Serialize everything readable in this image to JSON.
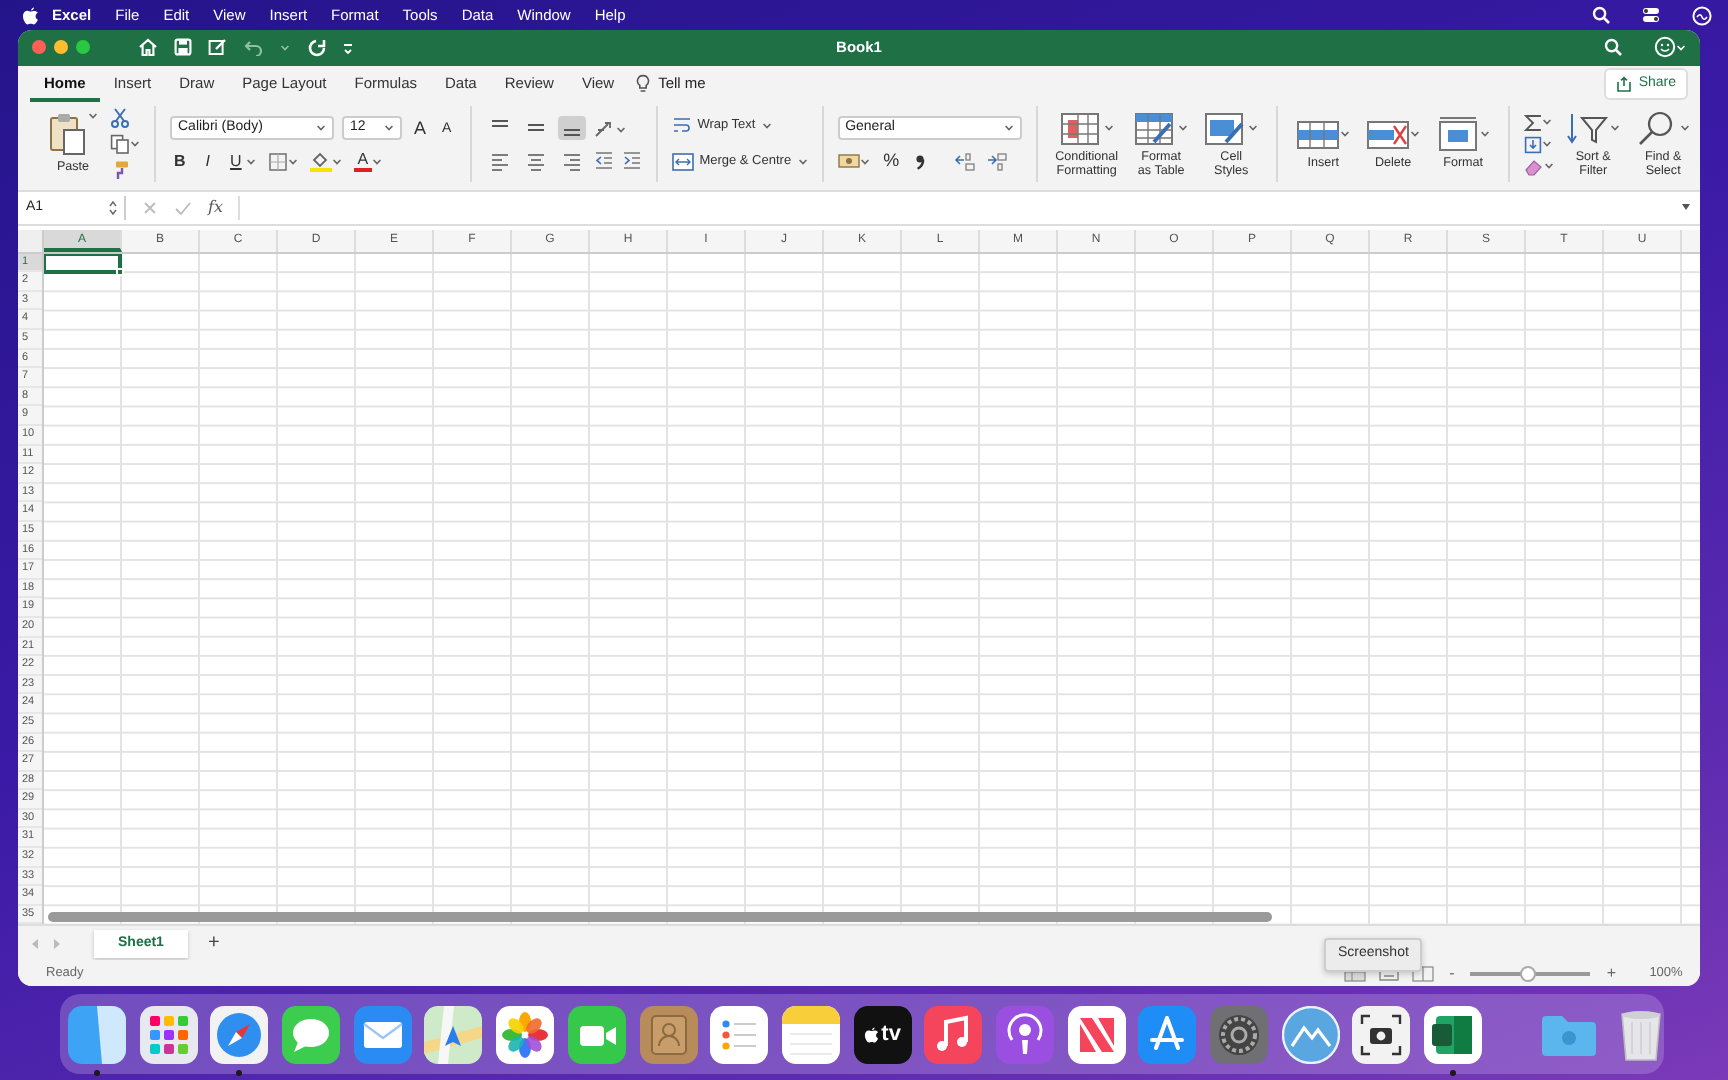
{
  "menubar": {
    "items": [
      {
        "label": "Excel",
        "kind": "app"
      },
      {
        "label": "File",
        "kind": "menu"
      },
      {
        "label": "Edit",
        "kind": "menu"
      },
      {
        "label": "View",
        "kind": "menu"
      },
      {
        "label": "Insert",
        "kind": "menu"
      },
      {
        "label": "Format",
        "kind": "menu"
      },
      {
        "label": "Tools",
        "kind": "menu"
      },
      {
        "label": "Data",
        "kind": "menu"
      },
      {
        "label": "Window",
        "kind": "menu"
      },
      {
        "label": "Help",
        "kind": "menu"
      }
    ]
  },
  "window": {
    "title": "Book1"
  },
  "ribbon_tabs": [
    {
      "label": "Home",
      "selected": true
    },
    {
      "label": "Insert",
      "selected": false
    },
    {
      "label": "Draw",
      "selected": false
    },
    {
      "label": "Page Layout",
      "selected": false
    },
    {
      "label": "Formulas",
      "selected": false
    },
    {
      "label": "Data",
      "selected": false
    },
    {
      "label": "Review",
      "selected": false
    },
    {
      "label": "View",
      "selected": false
    }
  ],
  "tell_me": "Tell me",
  "share": "Share",
  "clipboard": {
    "paste": "Paste"
  },
  "font": {
    "name": "Calibri (Body)",
    "size": "12",
    "grow": "A",
    "shrink": "A",
    "bold": "B",
    "italic": "I",
    "underline": "U",
    "color_button": "A"
  },
  "alignment": {
    "vertical": [
      {
        "kind": "top",
        "selected": false
      },
      {
        "kind": "middle",
        "selected": false
      },
      {
        "kind": "bottom",
        "selected": true
      }
    ],
    "horizontal": [
      {
        "kind": "left",
        "selected": false
      },
      {
        "kind": "center",
        "selected": false
      },
      {
        "kind": "right",
        "selected": false
      }
    ],
    "wrap_text": "Wrap Text",
    "merge": "Merge & Centre"
  },
  "number": {
    "format": "General",
    "percent": "%"
  },
  "large_buttons": [
    {
      "kind": "conditional",
      "label": "Conditional\nFormatting"
    },
    {
      "kind": "table",
      "label": "Format\nas Table"
    },
    {
      "kind": "styles",
      "label": "Cell\nStyles"
    },
    {
      "kind": "insert",
      "label": "Insert"
    },
    {
      "kind": "delete",
      "label": "Delete"
    },
    {
      "kind": "format",
      "label": "Format"
    },
    {
      "kind": "sort",
      "label": "Sort &\nFilter"
    },
    {
      "kind": "find",
      "label": "Find &\nSelect"
    }
  ],
  "formula_bar": {
    "name_box": "A1",
    "fx": "fx"
  },
  "sheet": {
    "columns": [
      {
        "label": "A",
        "selected": true
      },
      {
        "label": "B",
        "selected": false
      },
      {
        "label": "C",
        "selected": false
      },
      {
        "label": "D",
        "selected": false
      },
      {
        "label": "E",
        "selected": false
      },
      {
        "label": "F",
        "selected": false
      },
      {
        "label": "G",
        "selected": false
      },
      {
        "label": "H",
        "selected": false
      },
      {
        "label": "I",
        "selected": false
      },
      {
        "label": "J",
        "selected": false
      },
      {
        "label": "K",
        "selected": false
      },
      {
        "label": "L",
        "selected": false
      },
      {
        "label": "M",
        "selected": false
      },
      {
        "label": "N",
        "selected": false
      },
      {
        "label": "O",
        "selected": false
      },
      {
        "label": "P",
        "selected": false
      },
      {
        "label": "Q",
        "selected": false
      },
      {
        "label": "R",
        "selected": false
      },
      {
        "label": "S",
        "selected": false
      },
      {
        "label": "T",
        "selected": false
      },
      {
        "label": "U",
        "selected": false
      }
    ],
    "rows": [
      {
        "label": "1",
        "selected": true
      },
      {
        "label": "2",
        "selected": false
      },
      {
        "label": "3",
        "selected": false
      },
      {
        "label": "4",
        "selected": false
      },
      {
        "label": "5",
        "selected": false
      },
      {
        "label": "6",
        "selected": false
      },
      {
        "label": "7",
        "selected": false
      },
      {
        "label": "8",
        "selected": false
      },
      {
        "label": "9",
        "selected": false
      },
      {
        "label": "10",
        "selected": false
      },
      {
        "label": "11",
        "selected": false
      },
      {
        "label": "12",
        "selected": false
      },
      {
        "label": "13",
        "selected": false
      },
      {
        "label": "14",
        "selected": false
      },
      {
        "label": "15",
        "selected": false
      },
      {
        "label": "16",
        "selected": false
      },
      {
        "label": "17",
        "selected": false
      },
      {
        "label": "18",
        "selected": false
      },
      {
        "label": "19",
        "selected": false
      },
      {
        "label": "20",
        "selected": false
      },
      {
        "label": "21",
        "selected": false
      },
      {
        "label": "22",
        "selected": false
      },
      {
        "label": "23",
        "selected": false
      },
      {
        "label": "24",
        "selected": false
      },
      {
        "label": "25",
        "selected": false
      },
      {
        "label": "26",
        "selected": false
      },
      {
        "label": "27",
        "selected": false
      },
      {
        "label": "28",
        "selected": false
      },
      {
        "label": "29",
        "selected": false
      },
      {
        "label": "30",
        "selected": false
      },
      {
        "label": "31",
        "selected": false
      },
      {
        "label": "32",
        "selected": false
      },
      {
        "label": "33",
        "selected": false
      },
      {
        "label": "34",
        "selected": false
      },
      {
        "label": "35",
        "selected": false
      }
    ]
  },
  "sheet_tabs": [
    {
      "label": "Sheet1",
      "selected": true
    }
  ],
  "add_sheet": "+",
  "status": "Ready",
  "zoom": {
    "minus": "-",
    "plus": "+",
    "level": 0.47,
    "reading": "100%"
  },
  "tooltip": "Screenshot",
  "dock": {
    "apps": [
      {
        "kind": "finder",
        "running": true
      },
      {
        "kind": "launchpad",
        "running": false
      },
      {
        "kind": "safari",
        "running": true
      },
      {
        "kind": "messages",
        "running": false
      },
      {
        "kind": "mail",
        "running": false
      },
      {
        "kind": "maps",
        "running": false
      },
      {
        "kind": "photos",
        "running": false
      },
      {
        "kind": "facetime",
        "running": false
      },
      {
        "kind": "contacts",
        "running": false
      },
      {
        "kind": "reminders",
        "running": false
      },
      {
        "kind": "notes",
        "running": false
      },
      {
        "kind": "tv",
        "label": "tv",
        "running": false
      },
      {
        "kind": "music",
        "running": false
      },
      {
        "kind": "podcasts",
        "running": false
      },
      {
        "kind": "news",
        "running": false
      },
      {
        "kind": "appstore",
        "running": false
      },
      {
        "kind": "settings",
        "running": false
      },
      {
        "kind": "mountain",
        "running": false
      },
      {
        "kind": "screenshot",
        "running": false
      },
      {
        "kind": "excel",
        "running": true
      }
    ],
    "stacks": [
      {
        "kind": "folder"
      },
      {
        "kind": "trash"
      }
    ]
  }
}
